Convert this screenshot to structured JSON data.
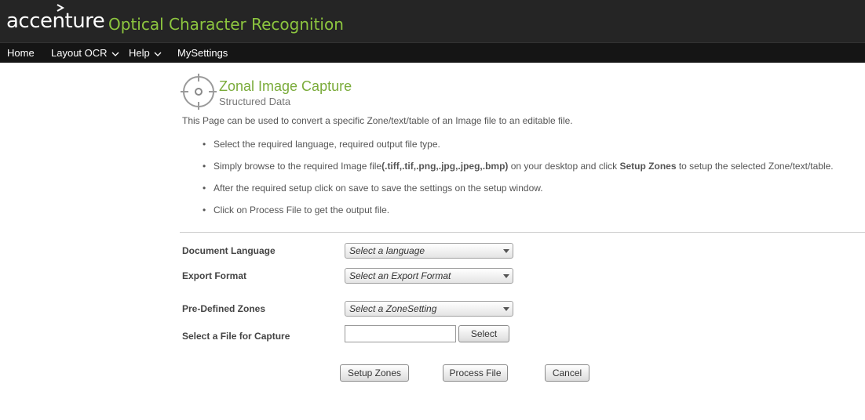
{
  "header": {
    "logo_text": "accenture",
    "app_title": "Optical Character Recognition"
  },
  "nav": {
    "items": [
      {
        "label": "Home",
        "has_dropdown": false
      },
      {
        "label": "Layout OCR",
        "has_dropdown": true
      },
      {
        "label": "Help",
        "has_dropdown": true
      },
      {
        "label": "MySettings",
        "has_dropdown": false
      }
    ]
  },
  "page": {
    "icon": "crosshair-target-icon",
    "title": "Zonal Image Capture",
    "subtitle": "Structured Data",
    "intro": "This Page can be used to convert a specific Zone/text/table of an Image file to an editable file.",
    "bullets": {
      "b1": "Select the required language, required output file type.",
      "b2_pre": "Simply browse to the required Image file",
      "b2_bold1": "(.tiff,.tif,.png,.jpg,.jpeg,.bmp)",
      "b2_mid": " on your desktop and click ",
      "b2_bold2": "Setup Zones",
      "b2_post": " to setup the selected Zone/text/table.",
      "b3": "After the required setup click on save to save the settings on the setup window.",
      "b4": "Click on Process File to get the output file."
    }
  },
  "form": {
    "language_label": "Document Language",
    "language_selected": "Select a language",
    "export_label": "Export Format",
    "export_selected": "Select an Export Format",
    "zones_label": "Pre-Defined Zones",
    "zones_selected": "Select a ZoneSetting",
    "file_label": "Select a File for Capture",
    "file_value": "",
    "select_button": "Select"
  },
  "actions": {
    "setup_zones": "Setup Zones",
    "process_file": "Process File",
    "cancel": "Cancel"
  },
  "colors": {
    "header_bg": "#252525",
    "nav_bg": "#151515",
    "accent_green": "#8dc63f",
    "title_green": "#7aab3a"
  }
}
